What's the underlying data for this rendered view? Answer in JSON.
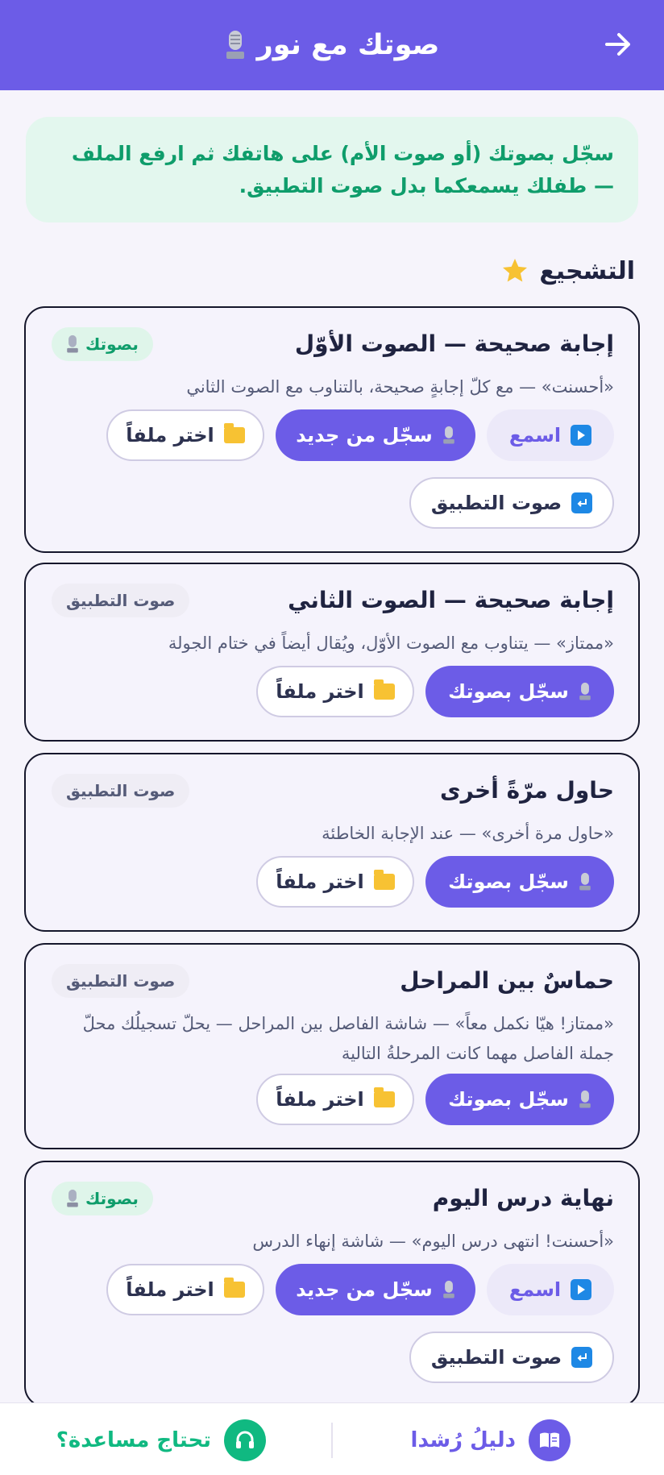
{
  "header": {
    "title": "صوتك مع نور",
    "back_icon": "arrow-right-icon",
    "color": "#6c5ce7"
  },
  "notice": {
    "text": "سجّل بصوتك (أو صوت الأم) على هاتفك ثم ارفع الملف — طفلك يسمعكما بدل صوت التطبيق."
  },
  "section": {
    "title": "التشجيع",
    "icon": "star-icon"
  },
  "cards": [
    {
      "title": "إجابة صحيحة — الصوت الأوّل",
      "desc": "«أحسنت» — مع كلّ إجابةٍ صحيحة، بالتناوب مع الصوت الثاني",
      "badge": "بصوتك",
      "listen_label": "اسمع",
      "rerecord_label": "سجّل من جديد",
      "choose_file_label": "اختر ملفاً",
      "revert_label": "صوت التطبيق"
    },
    {
      "title": "إجابة صحيحة — الصوت الثاني",
      "desc": "«ممتاز» — يتناوب مع الصوت الأوّل، ويُقال أيضاً في ختام الجولة",
      "badge": "صوت التطبيق",
      "record_label": "سجّل بصوتك",
      "choose_file_label": "اختر ملفاً"
    },
    {
      "title": "حاول مرّةً أخرى",
      "desc": "«حاول مرة أخرى» — عند الإجابة الخاطئة",
      "badge": "صوت التطبيق",
      "record_label": "سجّل بصوتك",
      "choose_file_label": "اختر ملفاً"
    },
    {
      "title": "حماسٌ بين المراحل",
      "desc": "«ممتاز! هيّا نكمل معاً» — شاشة الفاصل بين المراحل — يحلّ تسجيلُك محلّ جملة الفاصل مهما كانت المرحلةُ التالية",
      "badge": "صوت التطبيق",
      "record_label": "سجّل بصوتك",
      "choose_file_label": "اختر ملفاً"
    },
    {
      "title": "نهاية درس اليوم",
      "desc": "«أحسنت! انتهى درس اليوم» — شاشة إنهاء الدرس",
      "badge": "بصوتك",
      "listen_label": "اسمع",
      "rerecord_label": "سجّل من جديد",
      "choose_file_label": "اختر ملفاً",
      "revert_label": "صوت التطبيق"
    }
  ],
  "bottom_bar": {
    "guide_label": "دليلُ رُشدا",
    "guide_icon": "book-icon",
    "help_label": "تحتاج مساعدة؟",
    "help_icon": "headset-icon"
  }
}
